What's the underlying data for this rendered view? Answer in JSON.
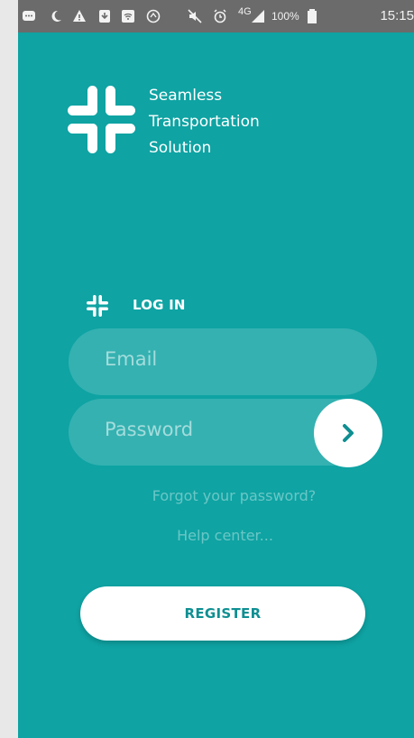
{
  "status_bar": {
    "network": "4G",
    "battery": "100%",
    "time": "15:15"
  },
  "brand": {
    "line1": "Seamless",
    "line2": "Transportation",
    "line3": "Solution"
  },
  "login": {
    "header": "LOG IN",
    "email_placeholder": "Email",
    "password_placeholder": "Password",
    "forgot_link": "Forgot your password?",
    "help_link": "Help center..."
  },
  "register": {
    "label": "REGISTER"
  },
  "colors": {
    "background": "#0fa3a3",
    "status_bar": "#6b6b6b",
    "accent_text": "#0f8f92"
  },
  "icons": [
    "message-icon",
    "moon-icon",
    "warning-icon",
    "download-icon",
    "wifi-icon",
    "compass-icon",
    "mute-icon",
    "alarm-icon",
    "signal-icon",
    "battery-icon",
    "logo-icon",
    "chevron-right-icon"
  ]
}
